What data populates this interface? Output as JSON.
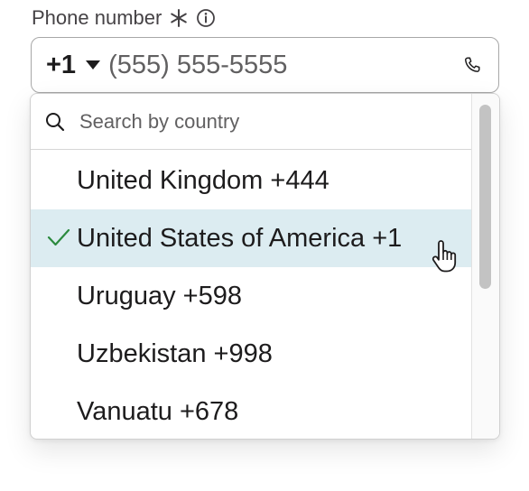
{
  "field": {
    "label": "Phone number",
    "required_marker": "required-asterisk-icon",
    "info_icon": "info-icon",
    "country_code": "+1",
    "phone_placeholder": "(555) 555-5555",
    "phone_icon": "phone-icon"
  },
  "dropdown": {
    "search_placeholder": "Search by country",
    "options": [
      {
        "label": "United Kingdom +444",
        "selected": false
      },
      {
        "label": "United States of America +1",
        "selected": true
      },
      {
        "label": "Uruguay +598",
        "selected": false
      },
      {
        "label": "Uzbekistan +998",
        "selected": false
      },
      {
        "label": "Vanuatu +678",
        "selected": false
      }
    ],
    "scroll_position": 0.0
  },
  "colors": {
    "selected_bg": "#dcecf1",
    "check_color": "#2b8a3e",
    "border": "#a8a8a8"
  }
}
